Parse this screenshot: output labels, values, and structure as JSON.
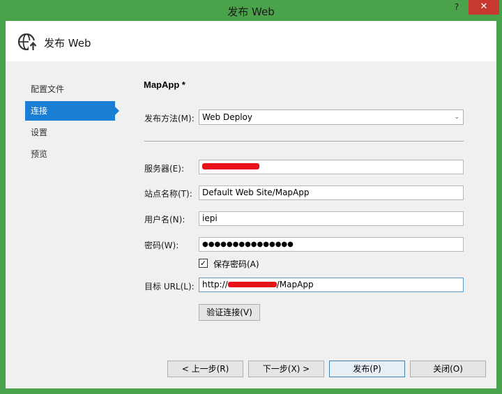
{
  "window": {
    "title": "发布 Web",
    "help_glyph": "?",
    "close_glyph": "✕"
  },
  "header": {
    "title": "发布 Web",
    "icon": "globe-publish-icon"
  },
  "nav": {
    "items": [
      {
        "label": "配置文件",
        "active": false
      },
      {
        "label": "连接",
        "active": true
      },
      {
        "label": "设置",
        "active": false
      },
      {
        "label": "预览",
        "active": false
      }
    ]
  },
  "main": {
    "section_title": "MapApp *",
    "publish_method": {
      "label": "发布方法(M):",
      "value": "Web Deploy",
      "arrow": "⌄"
    },
    "server": {
      "label": "服务器(E):",
      "value": "[redacted]"
    },
    "site_name": {
      "label": "站点名称(T):",
      "value": "Default Web Site/MapApp"
    },
    "username": {
      "label": "用户名(N):",
      "value": "iepi"
    },
    "password": {
      "label": "密码(W):",
      "value": "●●●●●●●●●●●●●●●"
    },
    "save_password": {
      "label": "保存密码(A)",
      "checked": true,
      "check_glyph": "✓"
    },
    "target_url": {
      "label": "目标 URL(L):",
      "prefix": "http://",
      "suffix": "/MapApp"
    },
    "validate_button": "验证连接(V)"
  },
  "footer": {
    "prev": "< 上一步(R)",
    "next": "下一步(X) >",
    "publish": "发布(P)",
    "close": "关闭(O)"
  },
  "colors": {
    "accent": "#1a7fd4",
    "titlebar": "#4aa34a",
    "close_button": "#c7382e",
    "redaction": "#e8121b"
  }
}
